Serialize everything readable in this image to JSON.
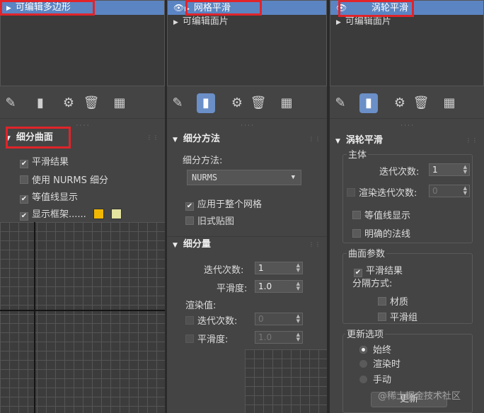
{
  "panel1": {
    "stack_item": "可编辑多边形",
    "rollout_title": "细分曲面",
    "opt_smooth": "平滑结果",
    "opt_nurms": "使用 NURMS 细分",
    "opt_isoline": "等值线显示",
    "opt_cage": "显示框架......",
    "cage_colors": [
      "#f2b700",
      "#e4e3a0"
    ]
  },
  "panel2": {
    "stack_item_1": "网格平滑",
    "stack_item_2": "可编辑面片",
    "rollout1_title": "细分方法",
    "method_label": "细分方法:",
    "method_value": "NURMS",
    "apply_whole": "应用于整个网格",
    "old_map": "旧式贴图",
    "rollout2_title": "细分量",
    "iter_label": "迭代次数:",
    "iter_value": "1",
    "smooth_label": "平滑度:",
    "smooth_value": "1.0",
    "render_label": "渲染值:",
    "r_iter_label": "迭代次数:",
    "r_iter_value": "0",
    "r_smooth_label": "平滑度:",
    "r_smooth_value": "1.0"
  },
  "panel3": {
    "stack_item_1": "涡轮平滑",
    "stack_item_2": "可编辑面片",
    "rollout_title": "涡轮平滑",
    "main_group": "主体",
    "iter_label": "迭代次数:",
    "iter_value": "1",
    "render_iter_label": "渲染迭代次数:",
    "render_iter_value": "0",
    "isoline": "等值线显示",
    "explicit_normals": "明确的法线",
    "surface_group": "曲面参数",
    "smooth_result": "平滑结果",
    "separate_by": "分隔方式:",
    "material": "材质",
    "smooth_group": "平滑组",
    "update_group": "更新选项",
    "always": "始终",
    "when_render": "渲染时",
    "manual": "手动",
    "update_button": "更新"
  },
  "watermark": "@稀土掘金技术社区",
  "accent_color": "#5b84c2",
  "highlight_color": "#e0242a",
  "icons": [
    "pin-icon",
    "show-end-result-icon",
    "make-unique-icon",
    "delete-icon",
    "configure-icon"
  ]
}
